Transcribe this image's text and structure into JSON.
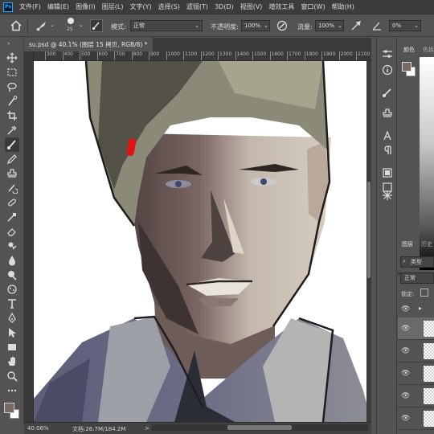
{
  "app": {
    "logo": "Ps"
  },
  "menu": [
    "文件(F)",
    "编辑(E)",
    "图像(I)",
    "图层(L)",
    "文字(Y)",
    "选择(S)",
    "滤镜(T)",
    "3D(D)",
    "视图(V)",
    "增效工具",
    "窗口(W)",
    "帮助(H)"
  ],
  "options": {
    "brush_size": "25",
    "mode_label": "模式:",
    "mode_value": "正常",
    "opacity_label": "不透明度:",
    "opacity_value": "100%",
    "flow_label": "流量:",
    "flow_value": "100%",
    "angle_value": "0%"
  },
  "document": {
    "tab_title": "su.psd @ 40.1% (图层 15 拷贝, RGB/8) *",
    "tab_close": "×"
  },
  "ruler": {
    "ticks": [
      "300",
      "400",
      "500",
      "600",
      "700",
      "800",
      "900",
      "1000",
      "1100",
      "1200",
      "1300",
      "1400",
      "1500",
      "1600",
      "1700",
      "1800",
      "1900",
      "2000",
      "2100"
    ]
  },
  "status": {
    "zoom": "40.06%",
    "doc_info": "文档:26.7M/184.2M",
    "arrow": ">"
  },
  "panels": {
    "color_tab": "颜色",
    "swatch_tab": "色板",
    "layers_tab": "图层",
    "history_tab": "历史",
    "kind_label": "类型",
    "blend_mode": "正常",
    "lock_label": "锁定:"
  },
  "colors": {
    "foreground": "#7b6a63",
    "background": "#ffffff",
    "accent": "#31a8ff"
  },
  "icons": [
    "move-icon",
    "marquee-icon",
    "lasso-icon",
    "quick-select-icon",
    "crop-icon",
    "eyedropper-icon",
    "brush-icon",
    "stamp-icon",
    "history-brush-icon",
    "eraser-icon",
    "gradient-icon",
    "blur-icon",
    "dodge-icon",
    "pen-icon",
    "type-icon",
    "path-select-icon",
    "shape-icon",
    "hand-icon",
    "zoom-icon",
    "more-icon"
  ]
}
